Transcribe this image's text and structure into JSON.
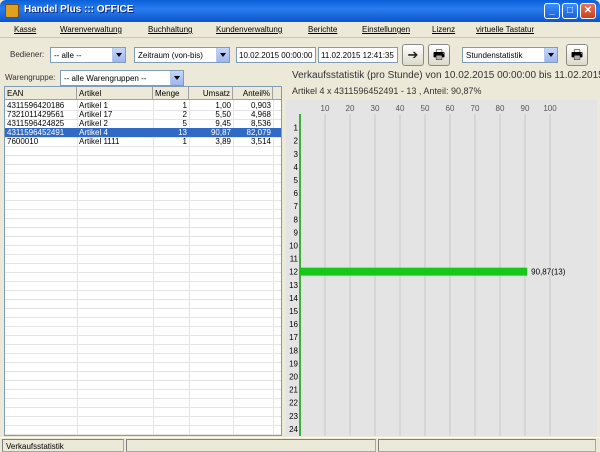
{
  "window": {
    "title": "Handel Plus ::: OFFICE",
    "minimize": "_",
    "maximize": "□",
    "close": "✕"
  },
  "menu": [
    "Kasse",
    "Warenverwaltung",
    "Buchhaltung",
    "Kundenverwaltung",
    "Berichte",
    "Einstellungen",
    "Lizenz",
    "virtuelle Tastatur"
  ],
  "toolbar": {
    "bediener_label": "Bediener:",
    "bediener_value": "-- alle --",
    "zeitraum_value": "Zeitraum (von-bis)",
    "date_from": "10.02.2015 00:00:00",
    "date_to": "11.02.2015 12:41:35",
    "go_icon": "arrow-right-icon",
    "print_icon": "printer-icon",
    "statistik_value": "Stundenstatistik",
    "print2_icon": "printer-icon"
  },
  "filter": {
    "warengruppe_label": "Warengruppe:",
    "warengruppe_value": "-- alle Warengruppen --"
  },
  "table": {
    "columns": [
      "EAN",
      "Artikel",
      "Menge",
      "Umsatz",
      "Anteil%"
    ],
    "rows": [
      {
        "ean": "4311596420186",
        "artikel": "Artikel 1",
        "menge": "1",
        "umsatz": "1,00",
        "anteil": "0,903"
      },
      {
        "ean": "7321011429561",
        "artikel": "Artikel 17",
        "menge": "2",
        "umsatz": "5,50",
        "anteil": "4,968"
      },
      {
        "ean": "4311596424825",
        "artikel": "Artikel 2",
        "menge": "5",
        "umsatz": "9,45",
        "anteil": "8,536"
      },
      {
        "ean": "4311596452491",
        "artikel": "Artikel 4",
        "menge": "13",
        "umsatz": "90,87",
        "anteil": "82,079"
      },
      {
        "ean": "7600010",
        "artikel": "Artikel 1111",
        "menge": "1",
        "umsatz": "3,89",
        "anteil": "3,514"
      }
    ],
    "selected_index": 3
  },
  "chart": {
    "title": "Verkaufsstatistik (pro Stunde) von 10.02.2015 00:00:00 bis 11.02.2015",
    "subtitle": "Artikel 4 x 4311596452491 - 13 , Anteil: 90,87%",
    "bar_color": "#18c818"
  },
  "chart_data": {
    "type": "bar",
    "orientation": "horizontal",
    "categories": [
      "1",
      "2",
      "3",
      "4",
      "5",
      "6",
      "7",
      "8",
      "9",
      "10",
      "11",
      "12",
      "13",
      "14",
      "15",
      "16",
      "17",
      "18",
      "19",
      "20",
      "21",
      "22",
      "23",
      "24"
    ],
    "values": [
      0,
      0,
      0,
      0,
      0,
      0,
      0,
      0,
      0,
      0,
      0,
      90.87,
      0,
      0,
      0,
      0,
      0,
      0,
      0,
      0,
      0,
      0,
      0,
      0
    ],
    "x_ticks": [
      "10",
      "20",
      "30",
      "40",
      "50",
      "60",
      "70",
      "80",
      "90",
      "100"
    ],
    "xlim": [
      0,
      100
    ],
    "data_labels": {
      "12": "90,87(13)"
    },
    "grid": true
  },
  "status": {
    "text": "Verkaufsstatistik"
  }
}
